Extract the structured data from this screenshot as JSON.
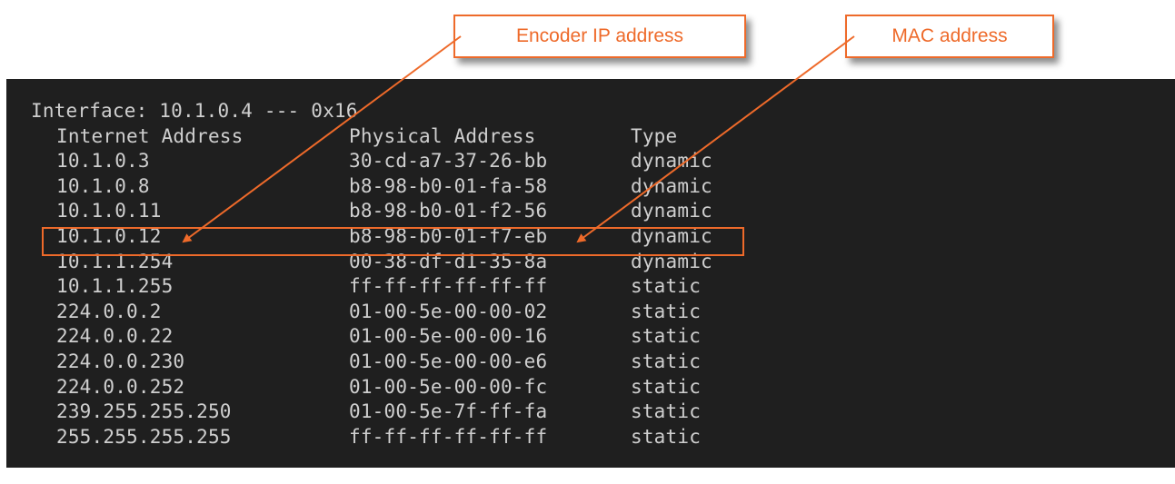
{
  "callouts": {
    "encoder_ip": "Encoder IP address",
    "mac": "MAC address"
  },
  "terminal": {
    "interface_line": "Interface: 10.1.0.4 --- 0x16",
    "headers": [
      "Internet Address",
      "Physical Address",
      "Type"
    ],
    "rows": [
      {
        "ip": "10.1.0.3",
        "mac": "30-cd-a7-37-26-bb",
        "type": "dynamic"
      },
      {
        "ip": "10.1.0.8",
        "mac": "b8-98-b0-01-fa-58",
        "type": "dynamic"
      },
      {
        "ip": "10.1.0.11",
        "mac": "b8-98-b0-01-f2-56",
        "type": "dynamic"
      },
      {
        "ip": "10.1.0.12",
        "mac": "b8-98-b0-01-f7-eb",
        "type": "dynamic"
      },
      {
        "ip": "10.1.1.254",
        "mac": "00-38-df-d1-35-8a",
        "type": "dynamic"
      },
      {
        "ip": "10.1.1.255",
        "mac": "ff-ff-ff-ff-ff-ff",
        "type": "static"
      },
      {
        "ip": "224.0.0.2",
        "mac": "01-00-5e-00-00-02",
        "type": "static"
      },
      {
        "ip": "224.0.0.22",
        "mac": "01-00-5e-00-00-16",
        "type": "static"
      },
      {
        "ip": "224.0.0.230",
        "mac": "01-00-5e-00-00-e6",
        "type": "static"
      },
      {
        "ip": "224.0.0.252",
        "mac": "01-00-5e-00-00-fc",
        "type": "static"
      },
      {
        "ip": "239.255.255.250",
        "mac": "01-00-5e-7f-ff-fa",
        "type": "static"
      },
      {
        "ip": "255.255.255.255",
        "mac": "ff-ff-ff-ff-ff-ff",
        "type": "static"
      }
    ]
  },
  "colors": {
    "accent": "#ee6a2a",
    "terminal_bg": "#1f1f1f",
    "terminal_text": "#cfcfcf"
  }
}
